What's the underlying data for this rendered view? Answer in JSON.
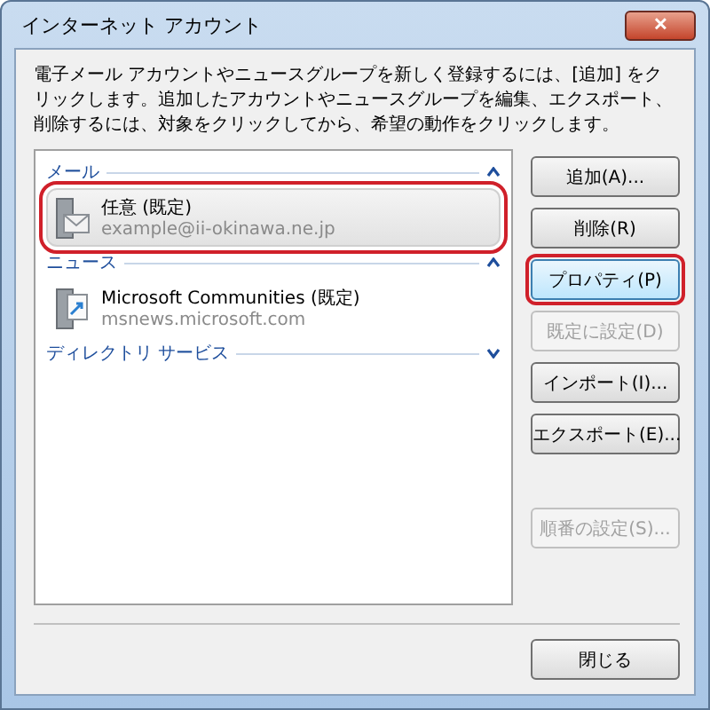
{
  "window": {
    "title": "インターネット アカウント",
    "close_label": "✕"
  },
  "description": "電子メール アカウントやニュースグループを新しく登録するには、[追加] をクリックします。追加したアカウントやニュースグループを編集、エクスポート、削除するには、対象をクリックしてから、希望の動作をクリックします。",
  "groups": [
    {
      "title": "メール",
      "expanded": true,
      "items": [
        {
          "kind": "mail",
          "name": "任意 (既定)",
          "address": "example@ii-okinawa.ne.jp",
          "selected": true,
          "highlighted": true
        }
      ]
    },
    {
      "title": "ニュース",
      "expanded": true,
      "items": [
        {
          "kind": "news",
          "name": "Microsoft Communities (既定)",
          "address": "msnews.microsoft.com",
          "selected": false,
          "highlighted": false
        }
      ]
    },
    {
      "title": "ディレクトリ サービス",
      "expanded": false
    }
  ],
  "buttons": [
    {
      "label": "追加(A)...",
      "disabled": false,
      "highlighted": false,
      "gap_before": false
    },
    {
      "label": "削除(R)",
      "disabled": false,
      "highlighted": false,
      "gap_before": false
    },
    {
      "label": "プロパティ(P)",
      "disabled": false,
      "highlighted": true,
      "gap_before": false
    },
    {
      "label": "既定に設定(D)",
      "disabled": true,
      "highlighted": false,
      "gap_before": false
    },
    {
      "label": "インポート(I)...",
      "disabled": false,
      "highlighted": false,
      "gap_before": false
    },
    {
      "label": "エクスポート(E)...",
      "disabled": false,
      "highlighted": false,
      "gap_before": false
    },
    {
      "label": "順番の設定(S)...",
      "disabled": true,
      "highlighted": false,
      "gap_before": true
    }
  ],
  "close_button": "閉じる"
}
